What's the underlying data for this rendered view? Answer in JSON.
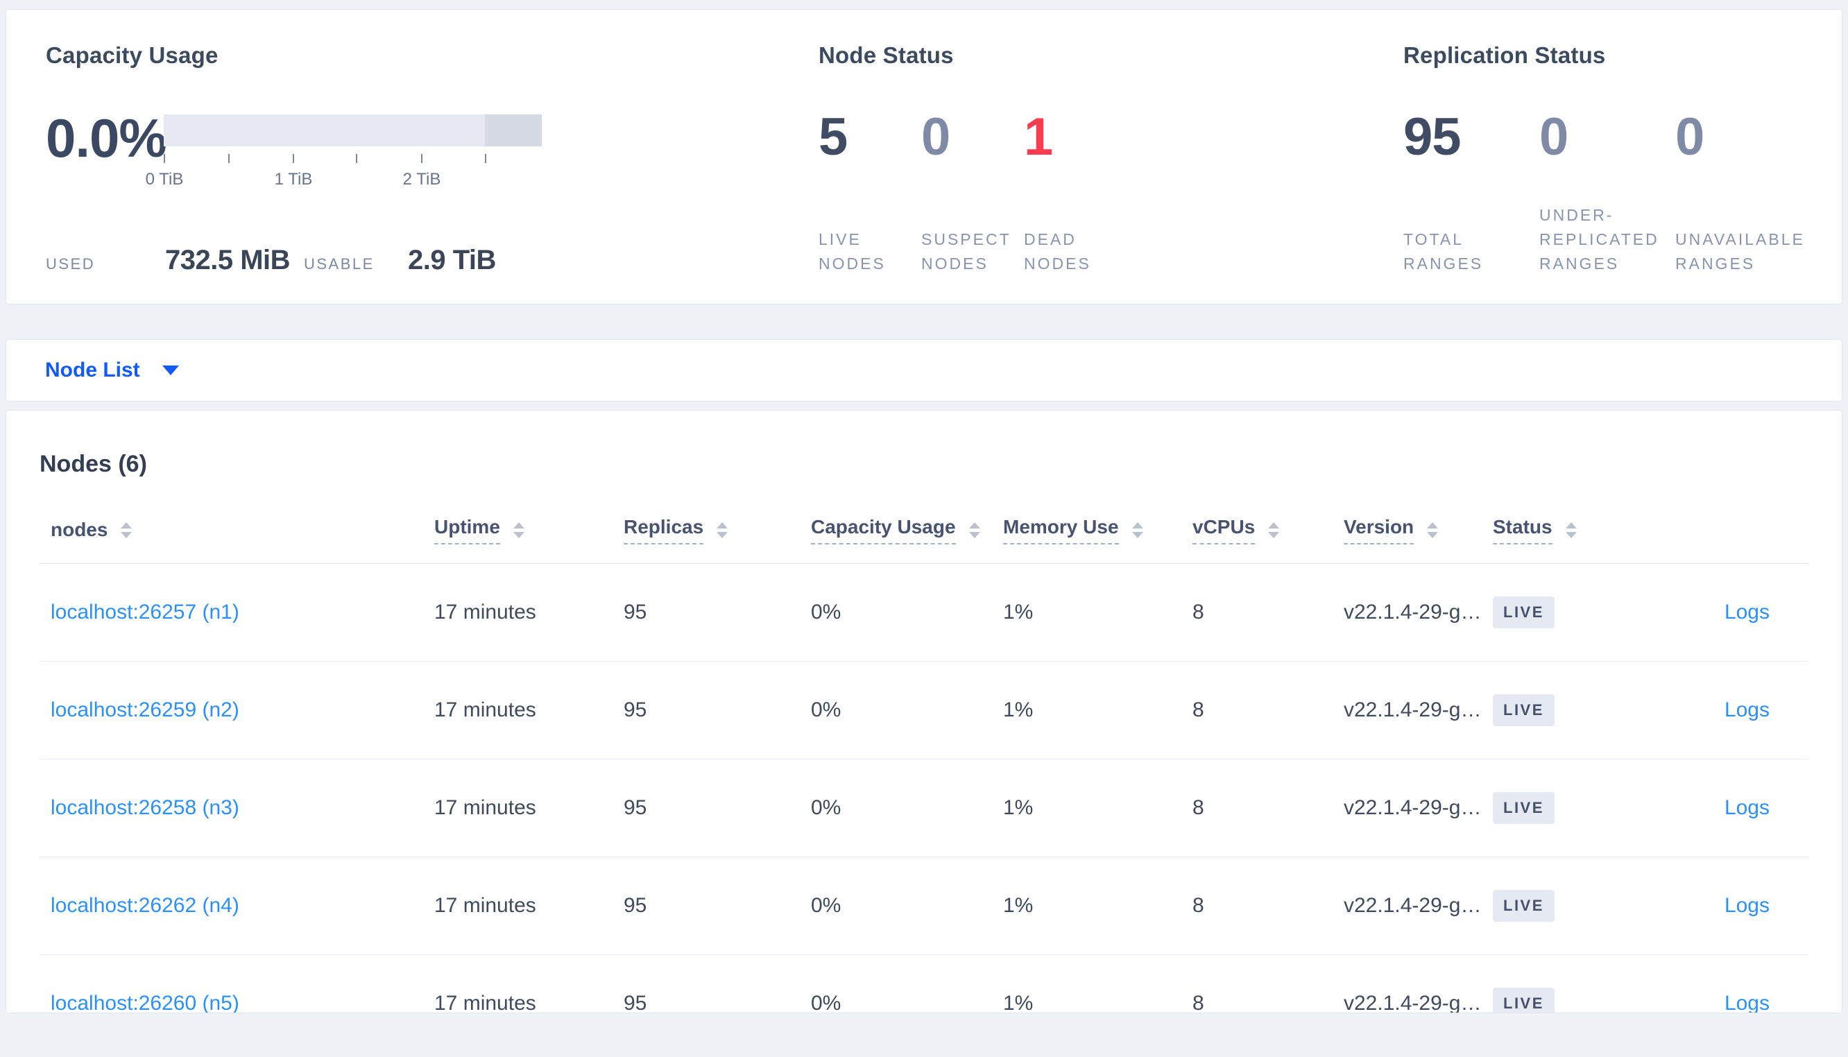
{
  "colors": {
    "page_background": "#eef1f6",
    "selector_blue": "#115aff",
    "table_link_blue": "#2b90f8",
    "dead_node_red": "#ff3b4f",
    "muted_value": "#7e8aa6",
    "dark_value": "#3f4c63",
    "badge_background": "#e5e9f1",
    "capacity_bar_light": "#e7e9f1",
    "capacity_bar_dark": "#d6dae4"
  },
  "summary": {
    "capacity": {
      "title": "Capacity Usage",
      "percent": "0.0%",
      "ticks": [
        "0 TiB",
        "1 TiB",
        "2 TiB"
      ],
      "used_label": "USED",
      "used_value": "732.5 MiB",
      "usable_label": "USABLE",
      "usable_value": "2.9 TiB"
    },
    "node_status": {
      "title": "Node Status",
      "metrics": [
        {
          "value": "5",
          "label": "LIVE NODES"
        },
        {
          "value": "0",
          "label": "SUSPECT NODES"
        },
        {
          "value": "1",
          "label": "DEAD NODES"
        }
      ]
    },
    "replication": {
      "title": "Replication Status",
      "metrics": [
        {
          "value": "95",
          "label": "TOTAL RANGES"
        },
        {
          "value": "0",
          "label": "UNDER-REPLICATED RANGES"
        },
        {
          "value": "0",
          "label": "UNAVAILABLE RANGES"
        }
      ]
    }
  },
  "view_selector": {
    "label": "Node List"
  },
  "nodes_section": {
    "heading": "Nodes (6)",
    "columns": [
      "nodes",
      "Uptime",
      "Replicas",
      "Capacity Usage",
      "Memory Use",
      "vCPUs",
      "Version",
      "Status"
    ],
    "rows": [
      {
        "address": "localhost:26257 (n1)",
        "uptime": "17 minutes",
        "replicas": "95",
        "capacity": "0%",
        "memory": "1%",
        "vcpus": "8",
        "version": "v22.1.4-29-g…",
        "status": "LIVE",
        "logs": "Logs"
      },
      {
        "address": "localhost:26259 (n2)",
        "uptime": "17 minutes",
        "replicas": "95",
        "capacity": "0%",
        "memory": "1%",
        "vcpus": "8",
        "version": "v22.1.4-29-g…",
        "status": "LIVE",
        "logs": "Logs"
      },
      {
        "address": "localhost:26258 (n3)",
        "uptime": "17 minutes",
        "replicas": "95",
        "capacity": "0%",
        "memory": "1%",
        "vcpus": "8",
        "version": "v22.1.4-29-g…",
        "status": "LIVE",
        "logs": "Logs"
      },
      {
        "address": "localhost:26262 (n4)",
        "uptime": "17 minutes",
        "replicas": "95",
        "capacity": "0%",
        "memory": "1%",
        "vcpus": "8",
        "version": "v22.1.4-29-g…",
        "status": "LIVE",
        "logs": "Logs"
      },
      {
        "address": "localhost:26260 (n5)",
        "uptime": "17 minutes",
        "replicas": "95",
        "capacity": "0%",
        "memory": "1%",
        "vcpus": "8",
        "version": "v22.1.4-29-g…",
        "status": "LIVE",
        "logs": "Logs"
      }
    ]
  }
}
